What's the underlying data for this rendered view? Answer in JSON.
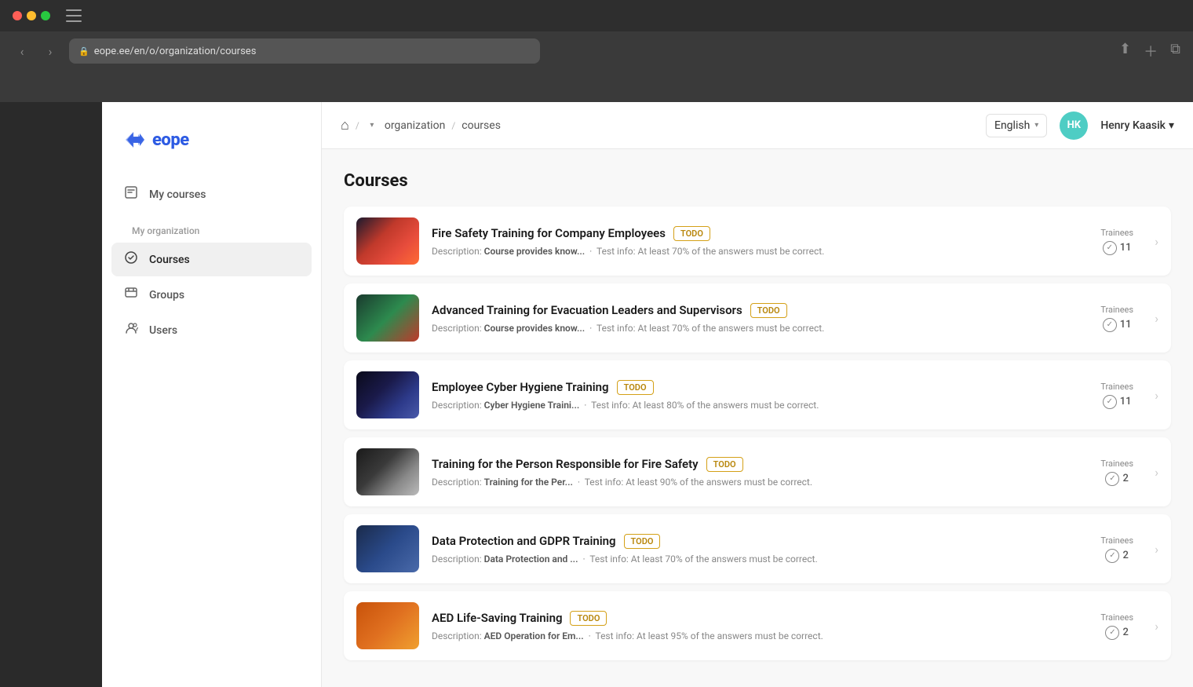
{
  "browser": {
    "url": "eope.ee/en/o/organization/courses",
    "lock_icon": "🔒"
  },
  "header": {
    "breadcrumb": {
      "home_icon": "⌂",
      "items": [
        "organization",
        "courses"
      ]
    },
    "language": {
      "label": "English",
      "chevron": "▾"
    },
    "user": {
      "initials": "HK",
      "name": "Henry Kaasik",
      "chevron": "▾"
    }
  },
  "sidebar": {
    "logo_text": "eope",
    "my_courses_label": "My courses",
    "org_section_label": "My organization",
    "nav_items": [
      {
        "id": "courses",
        "label": "Courses",
        "active": true
      },
      {
        "id": "groups",
        "label": "Groups",
        "active": false
      },
      {
        "id": "users",
        "label": "Users",
        "active": false
      }
    ]
  },
  "courses_page": {
    "title": "Courses",
    "courses": [
      {
        "id": 1,
        "title": "Fire Safety Training for Company Employees",
        "badge": "TODO",
        "description": "Course provides know...",
        "test_info": "At least 70% of the answers must be correct.",
        "trainees": 11,
        "thumb_class": "thumb-fire"
      },
      {
        "id": 2,
        "title": "Advanced Training for Evacuation Leaders and Supervisors",
        "badge": "TODO",
        "description": "Course provides know...",
        "test_info": "At least 70% of the answers must be correct.",
        "trainees": 11,
        "thumb_class": "thumb-evac"
      },
      {
        "id": 3,
        "title": "Employee Cyber Hygiene Training",
        "badge": "TODO",
        "description": "Cyber Hygiene Traini...",
        "test_info": "At least 80% of the answers must be correct.",
        "trainees": 11,
        "thumb_class": "thumb-cyber"
      },
      {
        "id": 4,
        "title": "Training for the Person Responsible for Fire Safety",
        "badge": "TODO",
        "description": "Training for the Per...",
        "test_info": "At least 90% of the answers must be correct.",
        "trainees": 2,
        "thumb_class": "thumb-fire2"
      },
      {
        "id": 5,
        "title": "Data Protection and GDPR Training",
        "badge": "TODO",
        "description": "Data Protection and ...",
        "test_info": "At least 70% of the answers must be correct.",
        "trainees": 2,
        "thumb_class": "thumb-gdpr"
      },
      {
        "id": 6,
        "title": "AED Life-Saving Training",
        "badge": "TODO",
        "description": "AED Operation for Em...",
        "test_info": "At least 95% of the answers must be correct.",
        "trainees": 2,
        "thumb_class": "thumb-aed"
      }
    ]
  },
  "labels": {
    "trainees": "Trainees",
    "description_prefix": "Description: ",
    "test_info_prefix": "Test info: "
  }
}
